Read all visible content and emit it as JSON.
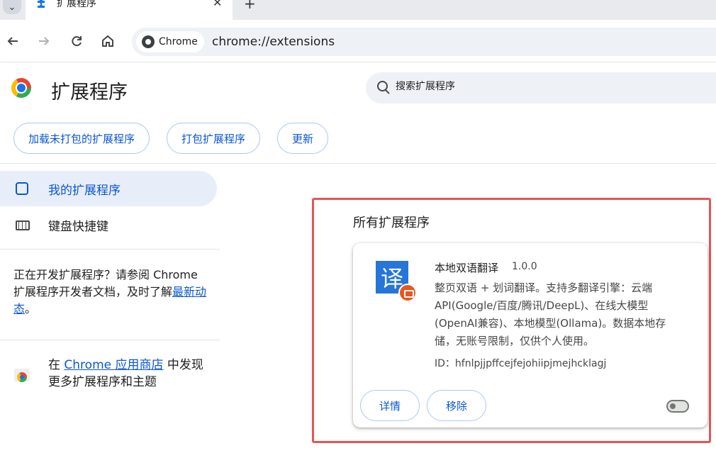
{
  "browser": {
    "tab_title": "扩展程序",
    "tab_close": "✕",
    "new_tab": "+",
    "tab_list": "⌄",
    "chip_label": "Chrome",
    "url": "chrome://extensions"
  },
  "header": {
    "title": "扩展程序",
    "search_placeholder": "搜索扩展程序"
  },
  "toolbar_buttons": {
    "load_unpacked": "加载未打包的扩展程序",
    "pack": "打包扩展程序",
    "update": "更新"
  },
  "sidebar": {
    "items": [
      {
        "label": "我的扩展程序",
        "active": true
      },
      {
        "label": "键盘快捷键",
        "active": false
      }
    ],
    "dev_note": {
      "prefix": "正在开发扩展程序？请参阅 Chrome 扩展程序开发者文档，及时了解",
      "link": "最新动态",
      "suffix": "。"
    },
    "store_note": {
      "prefix": "在 ",
      "link": "Chrome 应用商店",
      "suffix": " 中发现更多扩展程序和主题"
    }
  },
  "main": {
    "section_title": "所有扩展程序",
    "extension": {
      "icon_text": "译",
      "name": "本地双语翻译",
      "version": "1.0.0",
      "description": "整页双语 + 划词翻译。支持多翻译引擎：云端API(Google/百度/腾讯/DeepL)、在线大模型(OpenAI兼容)、本地模型(Ollama)。数据本地存储，无账号限制，仅供个人使用。",
      "id": "ID：hfnlpjjpffcejfejohiipjmejhcklagj",
      "details_label": "详情",
      "remove_label": "移除",
      "enabled": false
    }
  },
  "colors": {
    "accent": "#0b57d0",
    "highlight_frame": "#e45555",
    "ext_icon_bg": "#2675d8",
    "ext_badge": "#e8571c"
  }
}
